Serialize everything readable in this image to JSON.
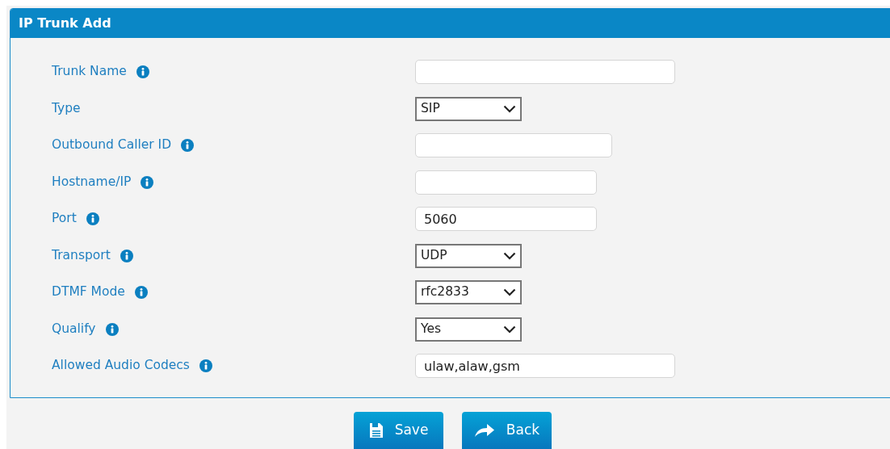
{
  "panel": {
    "title": "IP Trunk Add"
  },
  "fields": [
    {
      "kind": "text",
      "label": "Trunk Name",
      "info": true
    },
    {
      "kind": "select",
      "label": "Type",
      "info": false,
      "value": "SIP"
    },
    {
      "kind": "text",
      "label": "Outbound Caller ID",
      "info": true
    },
    {
      "kind": "text",
      "label": "Hostname/IP",
      "info": true
    },
    {
      "kind": "text",
      "label": "Port",
      "info": true,
      "value": "5060"
    },
    {
      "kind": "select",
      "label": "Transport",
      "info": true,
      "value": "UDP"
    },
    {
      "kind": "select",
      "label": "DTMF Mode",
      "info": true,
      "value": "rfc2833"
    },
    {
      "kind": "select",
      "label": "Qualify",
      "info": true,
      "value": "Yes"
    },
    {
      "kind": "text",
      "label": "Allowed Audio Codecs",
      "info": true,
      "value": "ulaw,alaw,gsm"
    }
  ],
  "buttons": [
    {
      "kind": "save",
      "label": "Save"
    },
    {
      "kind": "back",
      "label": "Back"
    }
  ]
}
